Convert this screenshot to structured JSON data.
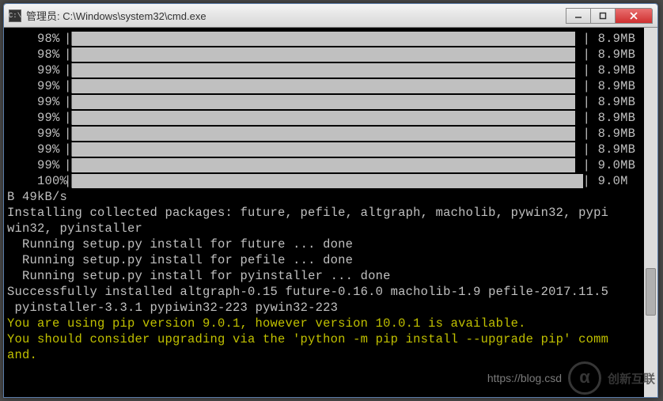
{
  "window": {
    "icon_label": "C:\\",
    "title": "管理员: C:\\Windows\\system32\\cmd.exe"
  },
  "progress": [
    {
      "pct": "98%",
      "size": "8.9MB"
    },
    {
      "pct": "98%",
      "size": "8.9MB"
    },
    {
      "pct": "99%",
      "size": "8.9MB"
    },
    {
      "pct": "99%",
      "size": "8.9MB"
    },
    {
      "pct": "99%",
      "size": "8.9MB"
    },
    {
      "pct": "99%",
      "size": "8.9MB"
    },
    {
      "pct": "99%",
      "size": "8.9MB"
    },
    {
      "pct": "99%",
      "size": "8.9MB"
    },
    {
      "pct": "99%",
      "size": "9.0MB"
    },
    {
      "pct": "100%",
      "size": "9.0M"
    }
  ],
  "lines": {
    "speed": "B 49kB/s",
    "installing": "Installing collected packages: future, pefile, altgraph, macholib, pywin32, pypi",
    "installing2": "win32, pyinstaller",
    "running1": "  Running setup.py install for future ... done",
    "running2": "  Running setup.py install for pefile ... done",
    "running3": "  Running setup.py install for pyinstaller ... done",
    "success1": "Successfully installed altgraph-0.15 future-0.16.0 macholib-1.9 pefile-2017.11.5",
    "success2": " pyinstaller-3.3.1 pypiwin32-223 pywin32-223",
    "warn1": "You are using pip version 9.0.1, however version 10.0.1 is available.",
    "warn2": "You should consider upgrading via the 'python -m pip install --upgrade pip' comm",
    "warn3": "and."
  },
  "watermark": {
    "url": "https://blog.csd",
    "logo": "α",
    "text": "创新互联"
  }
}
